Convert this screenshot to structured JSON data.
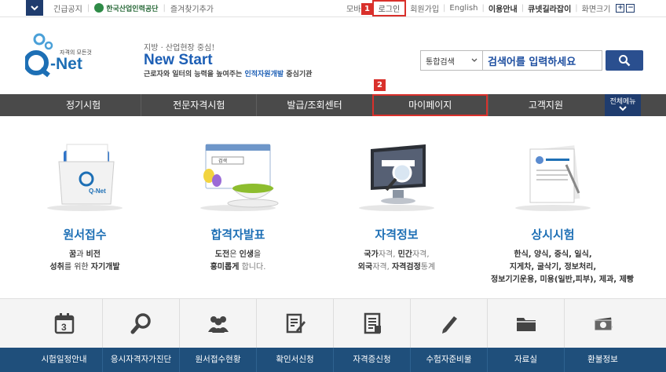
{
  "topbar": {
    "left_items": [
      "긴급공지",
      "즐겨찾기추가"
    ],
    "hrd_logo": "한국산업인력공단",
    "right_items": [
      "모바일",
      "로그인",
      "회원가입",
      "English",
      "이용안내",
      "큐넷길라잡이",
      "화면크기"
    ],
    "zoom_in": "+",
    "zoom_out": "−"
  },
  "badges": {
    "one": "1",
    "two": "2"
  },
  "logo": {
    "small": "자격의 모든것",
    "main_q": "Q",
    "main_net": "-Net"
  },
  "slogan": {
    "line1": "지방 · 산업현장 중심!",
    "line2": "New Start",
    "line3_a": "근로자와 일터의 능력을 높여주는 ",
    "line3_b": "인적자원개발",
    "line3_c": " 중심기관"
  },
  "search": {
    "select_value": "통합검색",
    "input_placeholder": "검색어를 입력하세요"
  },
  "gnb": {
    "items": [
      "정기시험",
      "전문자격시험",
      "발급/조회센터",
      "마이페이지",
      "고객지원"
    ],
    "all_menu": "전체메뉴"
  },
  "services": [
    {
      "title": "원서접수",
      "lines": [
        [
          "꿈과 비전",
          ""
        ],
        [
          "성취를 위한 자기개발",
          ""
        ]
      ]
    },
    {
      "title": "합격자발표",
      "lines": [
        [
          "도전은 인생을",
          ""
        ],
        [
          "흥미롭게 합니다.",
          ""
        ]
      ]
    },
    {
      "title": "자격정보",
      "lines": [
        [
          "국가자격, 민간자격,",
          ""
        ],
        [
          "외국자격, 자격검정통계",
          ""
        ]
      ]
    },
    {
      "title": "상시시험",
      "lines": [
        [
          "한식, 양식, 중식, 일식,",
          ""
        ],
        [
          "지게차, 굴삭기, 정보처리,",
          ""
        ],
        [
          "정보기기운용, 미용(일반,피부), 제과, 제빵",
          ""
        ]
      ]
    }
  ],
  "service_rich": {
    "s0": [
      "꿈",
      "과 ",
      "비전",
      "성취",
      "를 위한 ",
      "자기개발"
    ],
    "s1": [
      "도전",
      "은 ",
      "인생",
      "을",
      "흥미롭게",
      " 합니다."
    ],
    "s2": [
      "국가",
      "자격, ",
      "민간",
      "자격,",
      "외국",
      "자격, ",
      "자격검정",
      "통계"
    ]
  },
  "card_labels": {
    "qnet_small": "Q-Net",
    "search_small": "검색"
  },
  "quick": {
    "labels": [
      "시험일정안내",
      "응시자격자가진단",
      "원서접수현황",
      "확인서신청",
      "자격증신청",
      "수험자준비물",
      "자료실",
      "환불정보"
    ],
    "calendar_num": "3"
  },
  "colors": {
    "accent_blue": "#1d6fb5",
    "navy": "#1f3c6e",
    "gnb_bg": "#4a4a4a",
    "highlight_red": "#d9302b",
    "quick_bar": "#1f4f7b"
  },
  "icons": [
    "chevron-down-icon",
    "search-icon",
    "calendar-icon",
    "magnifier-icon",
    "people-icon",
    "document-edit-icon",
    "document-list-icon",
    "pencil-icon",
    "folder-icon",
    "money-icon"
  ]
}
